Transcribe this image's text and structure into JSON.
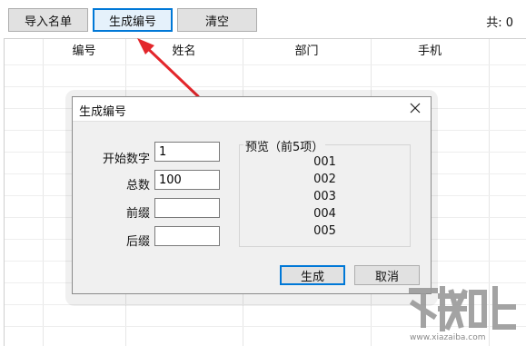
{
  "toolbar": {
    "import_label": "导入名单",
    "generate_label": "生成编号",
    "clear_label": "清空",
    "count_text": "共: 0"
  },
  "table": {
    "columns": [
      "编号",
      "姓名",
      "部门",
      "手机"
    ]
  },
  "dialog": {
    "title": "生成编号",
    "fields": {
      "start": {
        "label": "开始数字",
        "value": "1"
      },
      "total": {
        "label": "总数",
        "value": "100"
      },
      "prefix": {
        "label": "前缀",
        "value": ""
      },
      "suffix": {
        "label": "后缀",
        "value": ""
      }
    },
    "preview": {
      "title": "预览（前5项）",
      "items": [
        "001",
        "002",
        "003",
        "004",
        "005"
      ]
    },
    "ok_label": "生成",
    "cancel_label": "取消"
  },
  "watermark": {
    "text": "www.xiazaiba.com"
  },
  "colors": {
    "accent": "#0078d7",
    "arrow": "#e3262b"
  }
}
